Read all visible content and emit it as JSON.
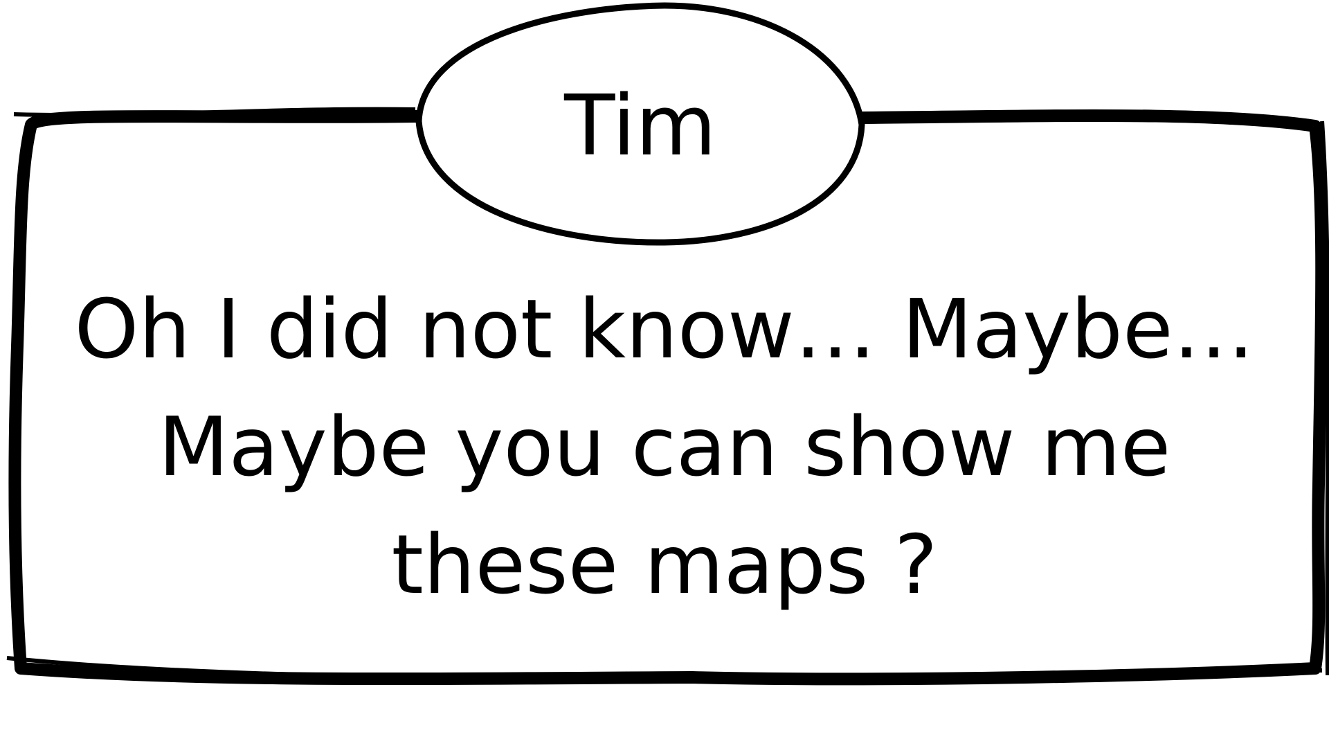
{
  "speaker": {
    "name": "Tim"
  },
  "dialogue": {
    "lines": [
      "Oh I did not know… Maybe…",
      "Maybe you can show me",
      "these maps ?"
    ]
  },
  "colors": {
    "ink": "#000000",
    "paper": "#ffffff"
  }
}
